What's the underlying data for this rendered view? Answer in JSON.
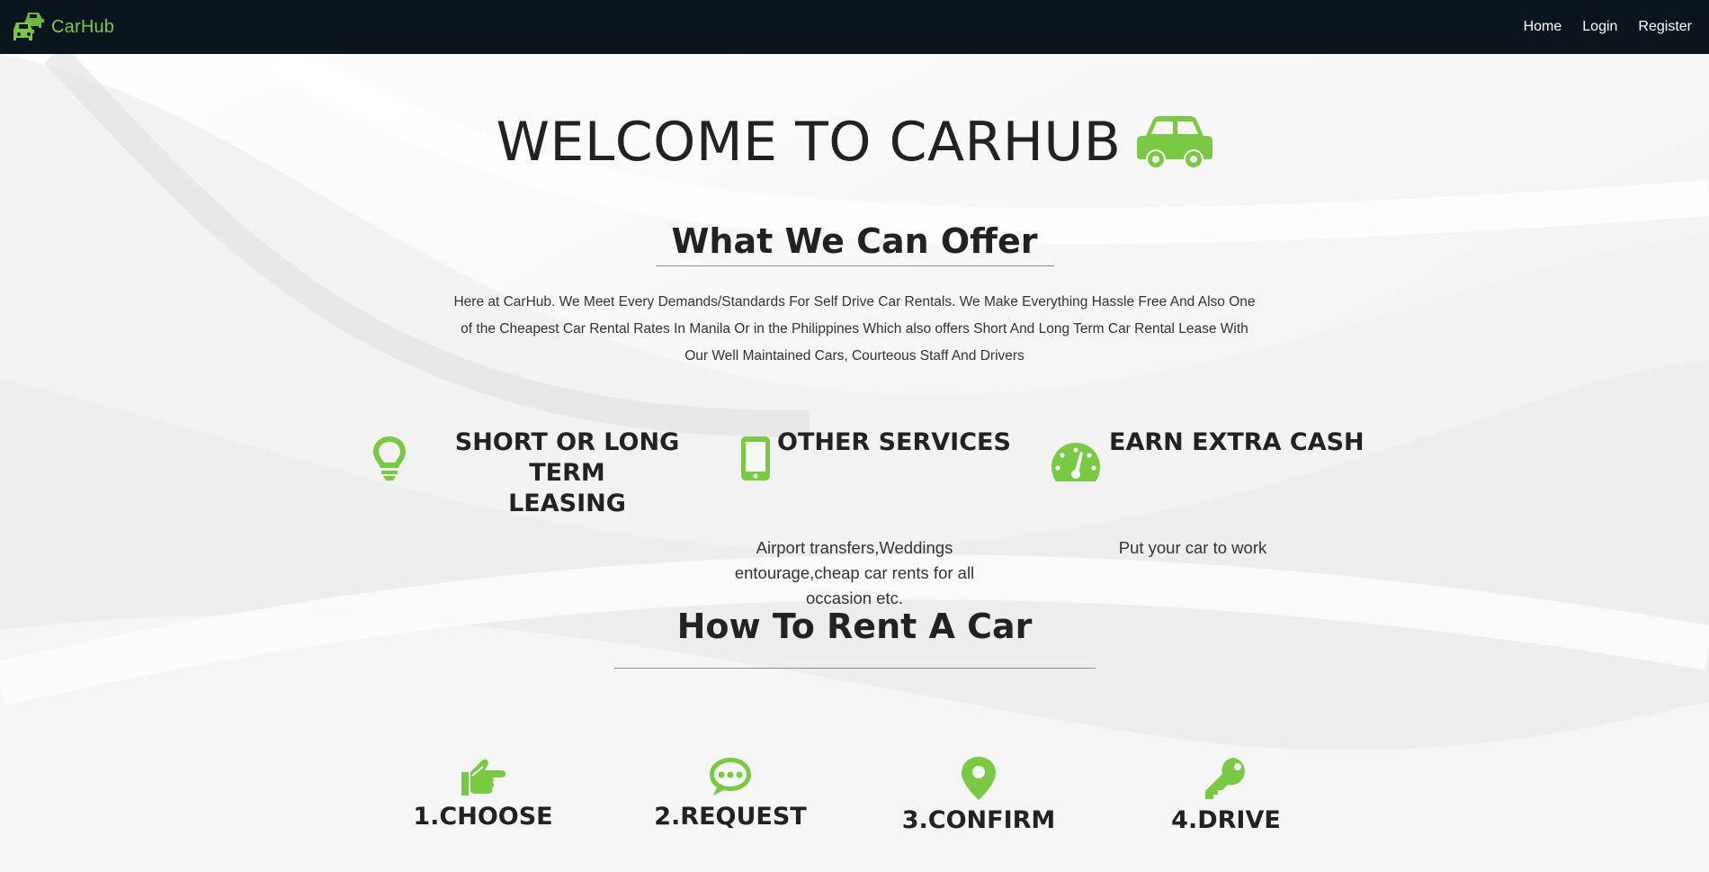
{
  "nav": {
    "brand": "CarHub",
    "links": [
      "Home",
      "Login",
      "Register"
    ]
  },
  "hero": {
    "title": "WELCOME TO CARHUB"
  },
  "offer": {
    "title": "What We Can Offer",
    "text": "Here at CarHub. We Meet Every Demands/Standards For Self Drive Car Rentals. We Make Everything Hassle Free And Also One of the Cheapest Car Rental Rates In Manila Or in the Philippines Which also offers Short And Long Term Car Rental Lease With Our Well Maintained Cars, Courteous Staff And Drivers"
  },
  "features": [
    {
      "title": "SHORT OR LONG TERM\nLEASING",
      "desc": "",
      "icon": "lightbulb-icon"
    },
    {
      "title": "OTHER SERVICES",
      "desc": "Airport transfers,Weddings entourage,cheap car rents for all occasion etc.",
      "icon": "mobile-phone-icon"
    },
    {
      "title": "EARN EXTRA CASH",
      "desc": "Put your car to work",
      "icon": "speedometer-icon"
    }
  ],
  "howto": {
    "title": "How To Rent A Car",
    "steps": [
      {
        "label": "1.CHOOSE",
        "icon": "pointing-hand-icon"
      },
      {
        "label": "2.REQUEST",
        "icon": "chat-bubble-icon"
      },
      {
        "label": "3.CONFIRM",
        "icon": "map-pin-icon"
      },
      {
        "label": "4.DRIVE",
        "icon": "key-icon"
      }
    ]
  },
  "colors": {
    "accent": "#7ac943",
    "navbar": "#0b151e",
    "text": "#222222"
  }
}
